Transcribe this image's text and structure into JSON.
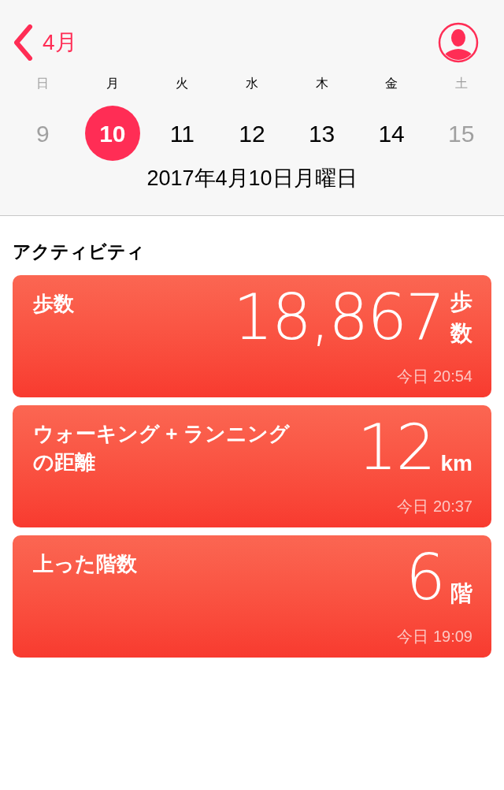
{
  "nav": {
    "back_label": "4月"
  },
  "week": [
    {
      "weekday": "日",
      "date": "9",
      "muted": true,
      "selected": false
    },
    {
      "weekday": "月",
      "date": "10",
      "muted": false,
      "selected": true
    },
    {
      "weekday": "火",
      "date": "11",
      "muted": false,
      "selected": false
    },
    {
      "weekday": "水",
      "date": "12",
      "muted": false,
      "selected": false
    },
    {
      "weekday": "木",
      "date": "13",
      "muted": false,
      "selected": false
    },
    {
      "weekday": "金",
      "date": "14",
      "muted": false,
      "selected": false
    },
    {
      "weekday": "土",
      "date": "15",
      "muted": true,
      "selected": false
    }
  ],
  "full_date": "2017年4月10日月曜日",
  "section_title": "アクティビティ",
  "cards": [
    {
      "title": "歩数",
      "value": "18,867",
      "unit": "歩数",
      "time": "今日 20:54"
    },
    {
      "title": "ウォーキング + ランニングの距離",
      "value": "12",
      "unit": "km",
      "time": "今日 20:37"
    },
    {
      "title": "上った階数",
      "value": "6",
      "unit": "階",
      "time": "今日 19:09"
    }
  ]
}
